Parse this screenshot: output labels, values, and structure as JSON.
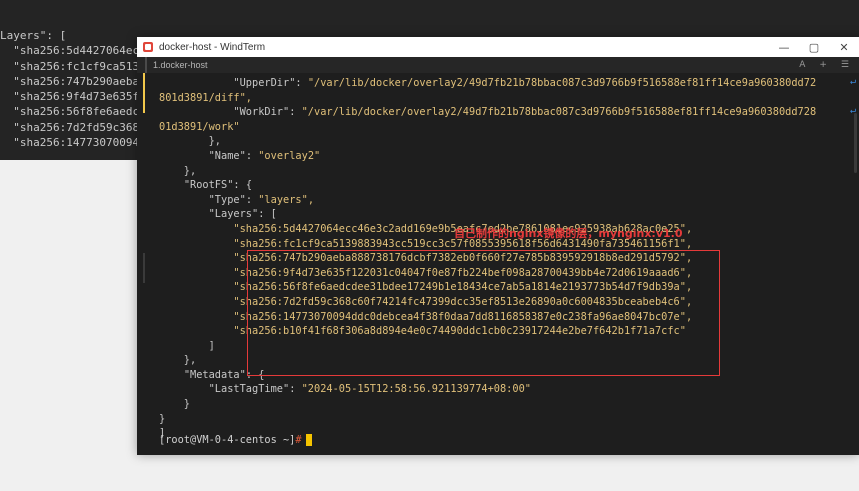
{
  "background_terminal": {
    "lines": [
      "Layers\": [",
      "  \"sha256:5d4427064ecc",
      "  \"sha256:fc1cf9ca5139",
      "  \"sha256:747b290aeba8",
      "  \"sha256:9f4d73e635f1",
      "  \"sha256:56f8fe6aedcd",
      "  \"sha256:7d2fd59c368c",
      "  \"sha256:14773070094c"
    ]
  },
  "window": {
    "title": "docker-host - WindTerm",
    "controls": {
      "minimize": "—",
      "maximize": "▢",
      "close": "✕"
    },
    "tab_label": "1.docker-host",
    "tab_right": [
      "A",
      "+",
      "☰"
    ]
  },
  "terminal": {
    "lines": [
      {
        "pre": "            ",
        "key": "\"UpperDir\"",
        "sep": ": ",
        "val": "\"/var/lib/docker/overlay2/49d7fb21b78bbac087c3d9766b9f516588ef81ff14ce9a960380dd72",
        "wrap": true
      },
      {
        "pre": "",
        "key": "",
        "sep": "",
        "val": "801d3891/diff\",",
        "wrap": false
      },
      {
        "pre": "            ",
        "key": "\"WorkDir\"",
        "sep": ": ",
        "val": "\"/var/lib/docker/overlay2/49d7fb21b78bbac087c3d9766b9f516588ef81ff14ce9a960380dd728",
        "wrap": true
      },
      {
        "pre": "",
        "key": "",
        "sep": "",
        "val": "01d3891/work\"",
        "wrap": false
      },
      {
        "pre": "        },",
        "key": "",
        "sep": "",
        "val": "",
        "wrap": false
      },
      {
        "pre": "        ",
        "key": "\"Name\"",
        "sep": ": ",
        "val": "\"overlay2\"",
        "wrap": false
      },
      {
        "pre": "    },",
        "key": "",
        "sep": "",
        "val": "",
        "wrap": false
      },
      {
        "pre": "    ",
        "key": "\"RootFS\"",
        "sep": ": {",
        "val": "",
        "wrap": false
      },
      {
        "pre": "        ",
        "key": "\"Type\"",
        "sep": ": ",
        "val": "\"layers\",",
        "wrap": false
      },
      {
        "pre": "        ",
        "key": "\"Layers\"",
        "sep": ": [",
        "val": "",
        "wrap": false
      },
      {
        "pre": "            ",
        "key": "",
        "sep": "",
        "val": "\"sha256:5d4427064ecc46e3c2add169e9b5eafc7ed2be7861081ec925938ab628ac0e25\",",
        "wrap": false
      },
      {
        "pre": "            ",
        "key": "",
        "sep": "",
        "val": "\"sha256:fc1cf9ca5139883943cc519cc3c57f0855395618f56d6431490fa735461156f1\",",
        "wrap": false
      },
      {
        "pre": "            ",
        "key": "",
        "sep": "",
        "val": "\"sha256:747b290aeba888738176dcbf7382eb0f660f27e785b839592918b8ed291d5792\",",
        "wrap": false
      },
      {
        "pre": "            ",
        "key": "",
        "sep": "",
        "val": "\"sha256:9f4d73e635f122031c04047f0e87fb224bef098a28700439bb4e72d0619aaad6\",",
        "wrap": false
      },
      {
        "pre": "            ",
        "key": "",
        "sep": "",
        "val": "\"sha256:56f8fe6aedcdee31bdee17249b1e18434ce7ab5a1814e2193773b54d7f9db39a\",",
        "wrap": false
      },
      {
        "pre": "            ",
        "key": "",
        "sep": "",
        "val": "\"sha256:7d2fd59c368c60f74214fc47399dcc35ef8513e26890a0c6004835bceabeb4c6\",",
        "wrap": false
      },
      {
        "pre": "            ",
        "key": "",
        "sep": "",
        "val": "\"sha256:14773070094ddc0debcea4f38f0daa7dd8116858387e0c238fa96ae8047bc07e\",",
        "wrap": false
      },
      {
        "pre": "            ",
        "key": "",
        "sep": "",
        "val": "\"sha256:b10f41f68f306a8d894e4e0c74490ddc1cb0c23917244e2be7f642b1f71a7cfc\"",
        "wrap": false
      },
      {
        "pre": "        ]",
        "key": "",
        "sep": "",
        "val": "",
        "wrap": false
      },
      {
        "pre": "    },",
        "key": "",
        "sep": "",
        "val": "",
        "wrap": false
      },
      {
        "pre": "    ",
        "key": "\"Metadata\"",
        "sep": ": {",
        "val": "",
        "wrap": false
      },
      {
        "pre": "        ",
        "key": "\"LastTagTime\"",
        "sep": ": ",
        "val": "\"2024-05-15T12:58:56.921139774+08:00\"",
        "wrap": false
      },
      {
        "pre": "    }",
        "key": "",
        "sep": "",
        "val": "",
        "wrap": false
      },
      {
        "pre": "}",
        "key": "",
        "sep": "",
        "val": "",
        "wrap": false
      },
      {
        "pre": "]",
        "key": "",
        "sep": "",
        "val": "",
        "wrap": false
      }
    ],
    "annotation": "自己制作的nginx镜像的层，mynginx:v1.0",
    "prompt": "[root@VM-0-4-centos ~]",
    "prompt_symbol": "#"
  }
}
